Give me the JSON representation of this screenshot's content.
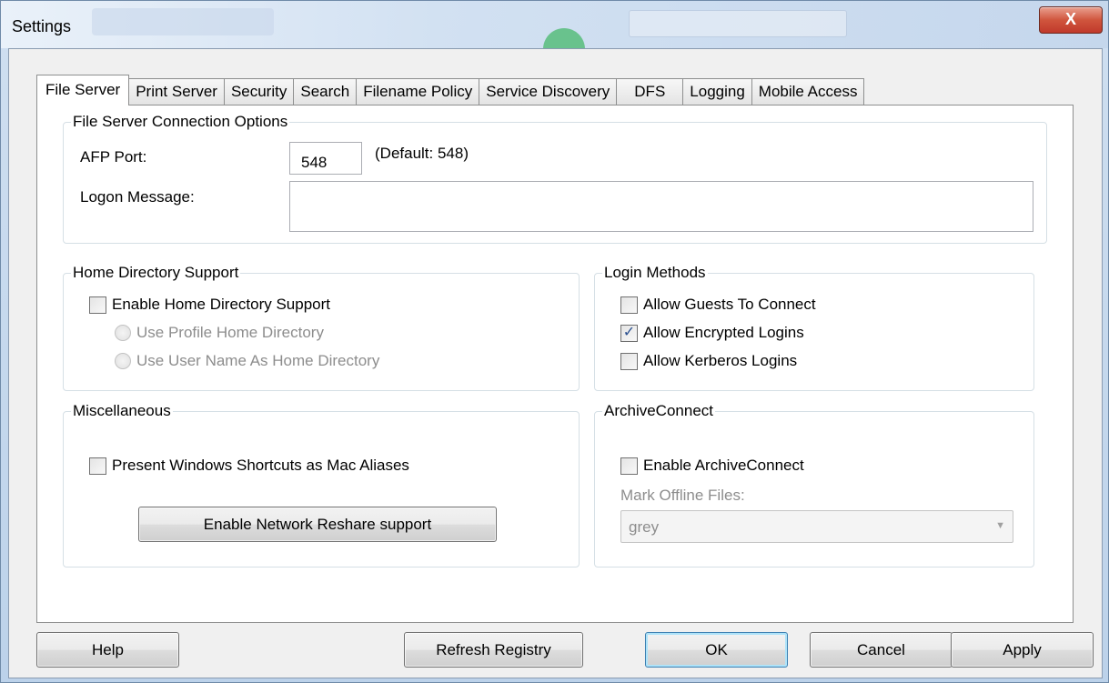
{
  "window": {
    "title": "Settings",
    "close_glyph": "X"
  },
  "tabs": [
    "File Server",
    "Print Server",
    "Security",
    "Search",
    "Filename Policy",
    "Service Discovery",
    "DFS",
    "Logging",
    "Mobile Access"
  ],
  "active_tab": "File Server",
  "connection_options": {
    "legend": "File Server Connection Options",
    "afp_port_label": "AFP Port:",
    "afp_port_value": "548",
    "afp_port_default": "(Default: 548)",
    "logon_message_label": "Logon Message:",
    "logon_message_value": ""
  },
  "home_directory": {
    "legend": "Home Directory Support",
    "enable_label": "Enable Home Directory Support",
    "enable_checked": false,
    "radio_profile": "Use Profile Home Directory",
    "radio_username": "Use User Name As Home Directory"
  },
  "login_methods": {
    "legend": "Login Methods",
    "guests_label": "Allow Guests To Connect",
    "guests_checked": false,
    "encrypted_label": "Allow Encrypted Logins",
    "encrypted_checked": true,
    "kerberos_label": "Allow Kerberos Logins",
    "kerberos_checked": false
  },
  "misc": {
    "legend": "Miscellaneous",
    "shortcuts_label": "Present Windows Shortcuts as Mac Aliases",
    "shortcuts_checked": false,
    "reshare_button": "Enable Network Reshare support"
  },
  "archive_connect": {
    "legend": "ArchiveConnect",
    "enable_label": "Enable ArchiveConnect",
    "enable_checked": false,
    "mark_offline_label": "Mark Offline Files:",
    "mark_offline_value": "grey"
  },
  "footer": {
    "help": "Help",
    "refresh": "Refresh Registry",
    "ok": "OK",
    "cancel": "Cancel",
    "apply": "Apply"
  },
  "icons": {
    "checkmark": "✓",
    "dropdown_arrow": "▼"
  }
}
